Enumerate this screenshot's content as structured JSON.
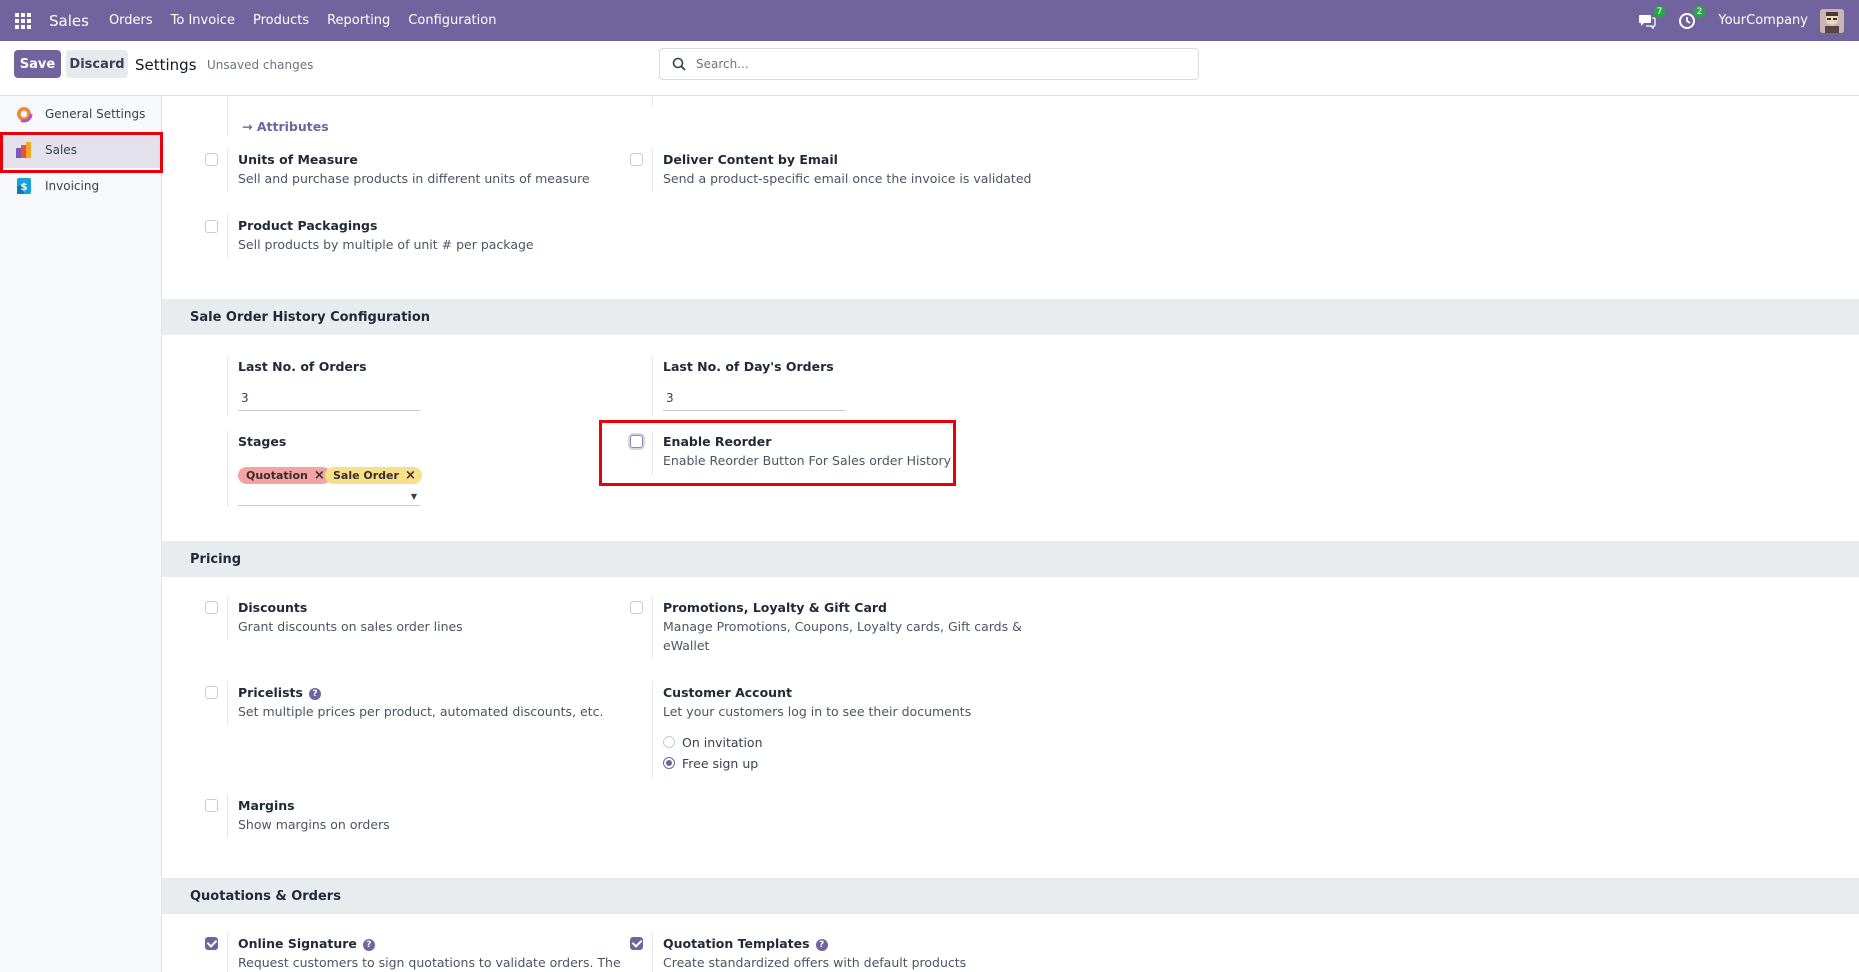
{
  "topnav": {
    "app_name": "Sales",
    "menu": [
      "Orders",
      "To Invoice",
      "Products",
      "Reporting",
      "Configuration"
    ],
    "messages_count": "7",
    "activities_count": "2",
    "company": "YourCompany",
    "bg_color": "#71639e"
  },
  "control": {
    "save_label": "Save",
    "discard_label": "Discard",
    "title": "Settings",
    "status": "Unsaved changes",
    "search_placeholder": "Search..."
  },
  "sidebar": {
    "items": [
      {
        "label": "General Settings",
        "icon": "odoo-settings-icon"
      },
      {
        "label": "Sales",
        "icon": "sales-app-icon",
        "active": true
      },
      {
        "label": "Invoicing",
        "icon": "invoicing-app-icon"
      }
    ]
  },
  "products": {
    "attributes_link": "Attributes",
    "uom_title": "Units of Measure",
    "uom_desc": "Sell and purchase products in different units of measure",
    "deliver_title": "Deliver Content by Email",
    "deliver_desc": "Send a product-specific email once the invoice is validated",
    "packaging_title": "Product Packagings",
    "packaging_desc": "Sell products by multiple of unit # per package"
  },
  "history": {
    "header": "Sale Order History Configuration",
    "last_orders_label": "Last No. of Orders",
    "last_orders_value": "3",
    "last_days_label": "Last No. of Day's Orders",
    "last_days_value": "3",
    "stages_label": "Stages",
    "stages": [
      "Quotation",
      "Sale Order"
    ],
    "reorder_title": "Enable Reorder",
    "reorder_desc": "Enable Reorder Button For Sales order History"
  },
  "pricing": {
    "header": "Pricing",
    "discounts_title": "Discounts",
    "discounts_desc": "Grant discounts on sales order lines",
    "promotions_title": "Promotions, Loyalty & Gift Card",
    "promotions_desc_1": "Manage Promotions, Coupons, Loyalty cards, Gift cards &",
    "promotions_desc_2": "eWallet",
    "pricelists_title": "Pricelists",
    "pricelists_desc": "Set multiple prices per product, automated discounts, etc.",
    "customer_title": "Customer Account",
    "customer_desc": "Let your customers log in to see their documents",
    "radio_options": [
      "On invitation",
      "Free sign up"
    ],
    "radio_selected": "Free sign up",
    "margins_title": "Margins",
    "margins_desc": "Show margins on orders"
  },
  "quotations": {
    "header": "Quotations & Orders",
    "signature_title": "Online Signature",
    "signature_desc": "Request customers to sign quotations to validate orders. The",
    "templates_title": "Quotation Templates",
    "templates_desc": "Create standardized offers with default products"
  }
}
